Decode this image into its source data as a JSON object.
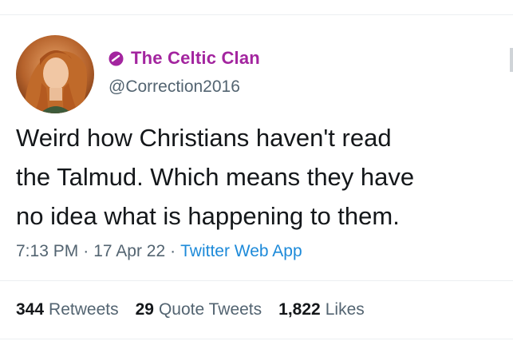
{
  "tweet": {
    "display_name": "The Celtic Clan",
    "handle": "@Correction2016",
    "text": "Weird how Christians haven't read\nthe Talmud. Which means they have\nno idea what is happening to them.",
    "time": "7:13 PM",
    "separator": "·",
    "date": "17 Apr 22",
    "source": "Twitter Web App",
    "retweets": {
      "count": "344",
      "label": "Retweets"
    },
    "quote_tweets": {
      "count": "29",
      "label": "Quote Tweets"
    },
    "likes": {
      "count": "1,822",
      "label": "Likes"
    }
  },
  "colors": {
    "name": "#a3259f",
    "secondary_text": "#536471",
    "link": "#1d8ad9",
    "text": "#14171a"
  },
  "icons": {
    "badge": "magenta-circle-slash-icon",
    "avatar": "profile-portrait"
  }
}
